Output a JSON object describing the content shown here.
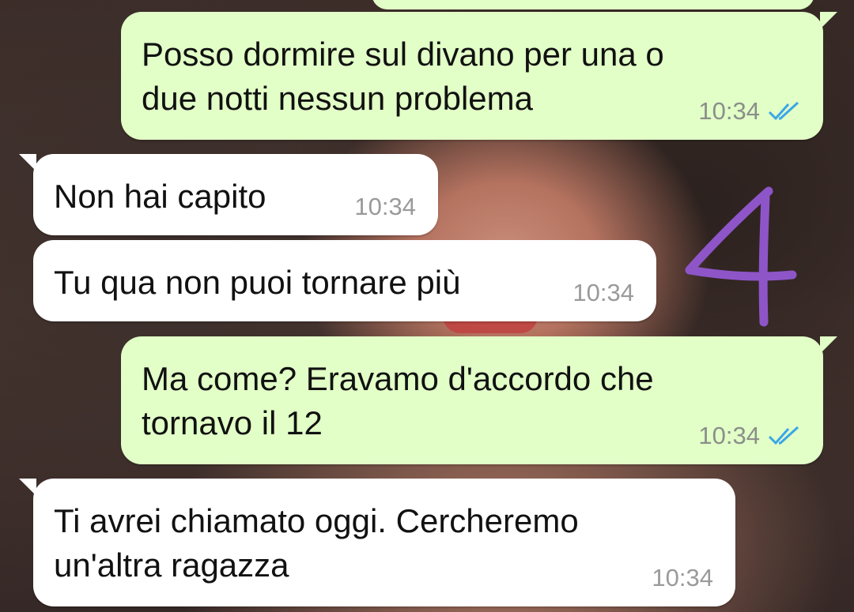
{
  "chat": {
    "messages": [
      {
        "direction": "outgoing",
        "text": "Posso dormire sul divano per una o\ndue notti nessun problema",
        "time": "10:34",
        "status": "read"
      },
      {
        "direction": "incoming",
        "text": "Non hai capito",
        "time": "10:34"
      },
      {
        "direction": "incoming",
        "text": "Tu qua non puoi tornare più",
        "time": "10:34"
      },
      {
        "direction": "outgoing",
        "text": "Ma come? Eravamo d'accordo che\ntornavo il 12",
        "time": "10:34",
        "status": "read"
      },
      {
        "direction": "incoming",
        "text": "Ti avrei chiamato oggi. Cercheremo\nun'altra ragazza",
        "time": "10:34"
      }
    ]
  },
  "annotation": {
    "text": "4",
    "color": "#8e55c8"
  },
  "colors": {
    "outgoing_bubble": "#e2ffc7",
    "incoming_bubble": "#ffffff",
    "read_ticks": "#3aa6e8"
  }
}
